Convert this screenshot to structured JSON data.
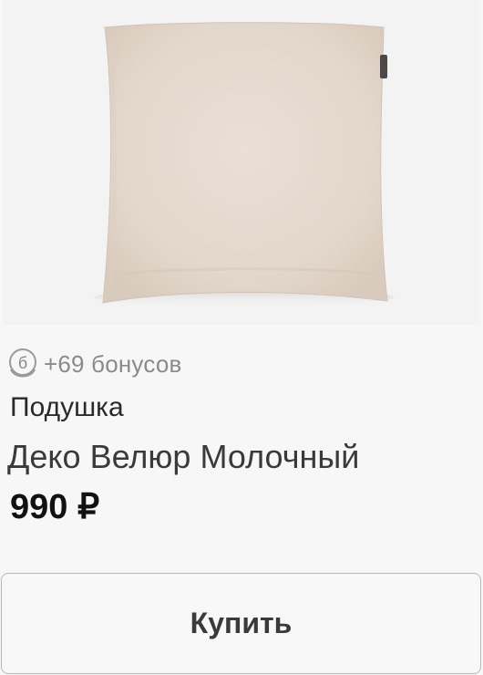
{
  "product": {
    "image_alt": "pillow-photo",
    "bonus_text": "+69 бонусов",
    "bonus_icon": "bonus-coin-icon",
    "type": "Подушка",
    "name": "Деко Велюр Молочный",
    "price": "990 ₽",
    "fabric_color": "#e6dbd0"
  },
  "actions": {
    "buy_label": "Купить"
  }
}
